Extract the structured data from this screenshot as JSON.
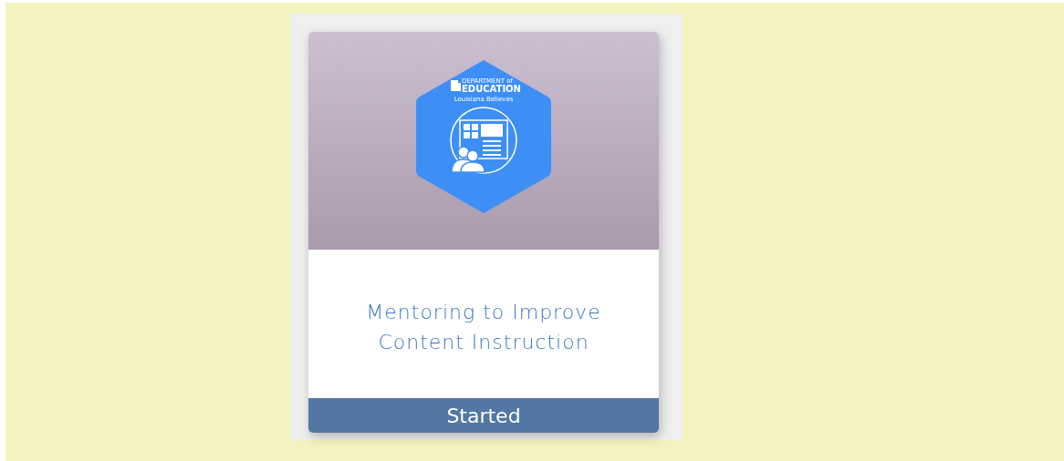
{
  "card": {
    "title": "Mentoring to Improve Content Instruction",
    "status": "Started",
    "badge": {
      "org_top": "DEPARTMENT of",
      "org_name": "EDUCATION",
      "tagline": "Louisiana Believes"
    }
  }
}
